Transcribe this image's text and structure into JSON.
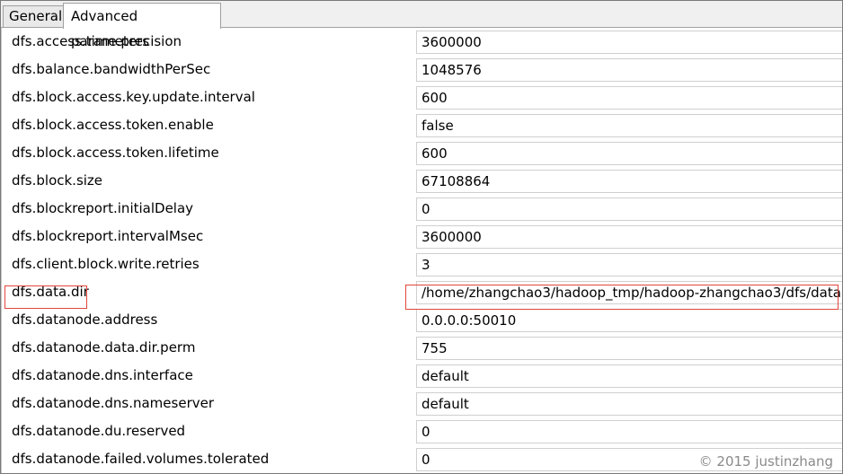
{
  "tabs": [
    {
      "label": "General",
      "active": false
    },
    {
      "label": "Advanced parameters",
      "active": true
    }
  ],
  "parameters": [
    {
      "name": "dfs.access.time.precision",
      "value": "3600000"
    },
    {
      "name": "dfs.balance.bandwidthPerSec",
      "value": "1048576"
    },
    {
      "name": "dfs.block.access.key.update.interval",
      "value": "600"
    },
    {
      "name": "dfs.block.access.token.enable",
      "value": "false"
    },
    {
      "name": "dfs.block.access.token.lifetime",
      "value": "600"
    },
    {
      "name": "dfs.block.size",
      "value": "67108864"
    },
    {
      "name": "dfs.blockreport.initialDelay",
      "value": "0"
    },
    {
      "name": "dfs.blockreport.intervalMsec",
      "value": "3600000"
    },
    {
      "name": "dfs.client.block.write.retries",
      "value": "3"
    },
    {
      "name": "dfs.data.dir",
      "value": "/home/zhangchao3/hadoop_tmp/hadoop-zhangchao3/dfs/data",
      "highlighted": true
    },
    {
      "name": "dfs.datanode.address",
      "value": "0.0.0.0:50010"
    },
    {
      "name": "dfs.datanode.data.dir.perm",
      "value": "755"
    },
    {
      "name": "dfs.datanode.dns.interface",
      "value": "default"
    },
    {
      "name": "dfs.datanode.dns.nameserver",
      "value": "default"
    },
    {
      "name": "dfs.datanode.du.reserved",
      "value": "0"
    },
    {
      "name": "dfs.datanode.failed.volumes.tolerated",
      "value": "0"
    }
  ],
  "highlight_color": "#e0463a",
  "watermark": "© 2015 justinzhang"
}
